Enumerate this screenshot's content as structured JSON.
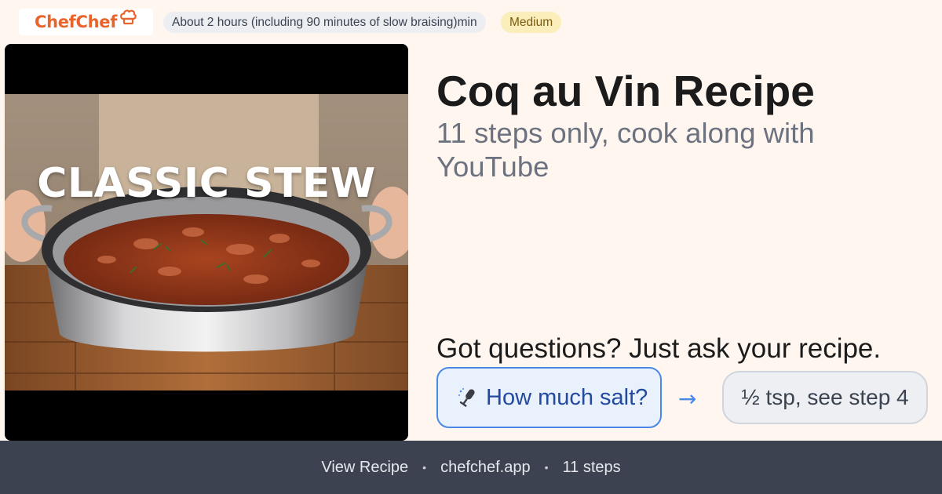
{
  "header": {
    "logo_text": "ChefChef",
    "logo_icon": "chef-hat-icon",
    "cook_time": "About 2 hours (including 90 minutes of slow braising)min",
    "difficulty": "Medium"
  },
  "video": {
    "thumbnail_caption": "CLASSIC STEW"
  },
  "recipe": {
    "title": "Coq au Vin Recipe",
    "subtitle": "11 steps only, cook along with YouTube"
  },
  "assistant": {
    "prompt": "Got questions? Just ask your recipe.",
    "example_question": "How much salt?",
    "example_answer": "½ tsp, see step 4",
    "question_icon": "microphone-icon",
    "arrow_icon": "right-arrow-icon"
  },
  "footer": {
    "view_recipe": "View Recipe",
    "site": "chefchef.app",
    "steps": "11 steps",
    "separator": "•"
  },
  "colors": {
    "background": "#fef6ef",
    "brand_orange": "#e8642c",
    "accent_blue": "#4a88e8",
    "footer_bg": "#3c4250",
    "difficulty_bg": "#fbeeba"
  }
}
